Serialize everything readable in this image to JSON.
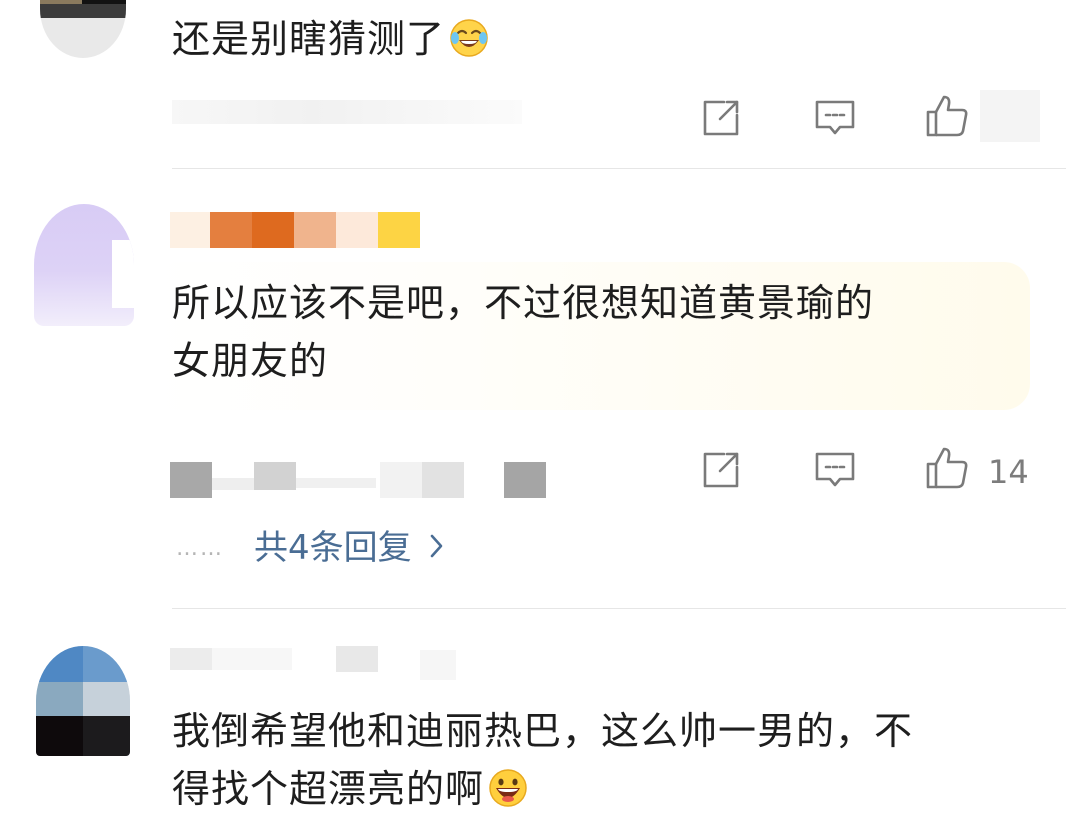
{
  "comments": [
    {
      "text": "还是别瞎猜测了",
      "emoji": "laughing-tears-emoji",
      "like_count": ""
    },
    {
      "text_line1": "所以应该不是吧，不过很想知道黄景瑜的",
      "text_line2": "女朋友的",
      "like_count": "14",
      "replies_dots": "……",
      "replies_label": "共4条回复"
    },
    {
      "text_line1": "我倒希望他和迪丽热巴，这么帅一男的，不",
      "text_line2": "得找个超漂亮的啊",
      "emoji": "grinning-emoji"
    }
  ],
  "icons": {
    "share": "share-icon",
    "comment": "comment-icon",
    "like": "thumbs-up-icon",
    "chevron": "chevron-right-icon"
  },
  "colors": {
    "link": "#4a6d94",
    "icon": "#7a7a7a",
    "highlight_bubble": "#fffbec"
  }
}
